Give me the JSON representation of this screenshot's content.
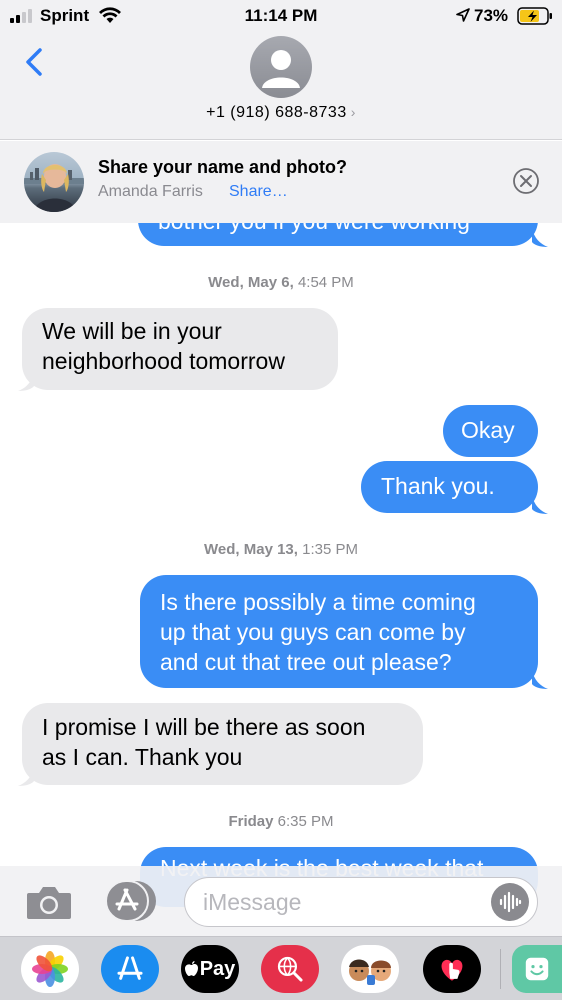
{
  "status_bar": {
    "carrier": "Sprint",
    "time": "11:14 PM",
    "battery_percent": "73%",
    "battery_level": 0.73,
    "signal_bars": 2,
    "icons": [
      "signal-icon",
      "wifi-icon",
      "location-icon",
      "battery-icon"
    ]
  },
  "header": {
    "back_icon": "chevron-left-icon",
    "avatar_icon": "person-icon",
    "phone_number": "+1 (918) 688-8733",
    "chevron": "›"
  },
  "share_banner": {
    "title": "Share your name and photo?",
    "name": "Amanda Farris",
    "share_link": "Share…",
    "close_icon": "close-circle-icon"
  },
  "messages": {
    "partial_top": "bother you if you were working",
    "ts1": {
      "day": "Wed, May 6,",
      "time": "4:54 PM"
    },
    "m1": {
      "direction": "in",
      "lines": [
        "We will be in your",
        "neighborhood tomorrow"
      ]
    },
    "m2": {
      "direction": "out",
      "text": "Okay"
    },
    "m3": {
      "direction": "out",
      "text": "Thank you."
    },
    "ts2": {
      "day": "Wed, May 13,",
      "time": "1:35 PM"
    },
    "m4": {
      "direction": "out",
      "lines": [
        "Is there possibly a time coming",
        "up that you guys can come by",
        "and cut that tree out please?"
      ]
    },
    "m5": {
      "direction": "in",
      "lines": [
        "I promise I will be there as soon",
        "as I can. Thank you"
      ]
    },
    "ts3": {
      "day": "Friday",
      "time": "6:35 PM"
    },
    "partial_bottom": "Next week is the best week that"
  },
  "input_bar": {
    "placeholder": "iMessage",
    "value": "",
    "camera_icon": "camera-icon",
    "apps_icon": "app-store-icon",
    "audio_icon": "waveform-icon"
  },
  "app_drawer": {
    "apps": [
      "photos-icon",
      "app-store-icon",
      "apple-pay-icon",
      "web-search-icon",
      "memoji-icon",
      "digital-touch-icon",
      "sticker-app-icon"
    ],
    "apple_pay_label": "Pay"
  },
  "colors": {
    "outgoing_bubble": "#3a8df5",
    "incoming_bubble": "#e9e9eb",
    "accent": "#2f7cf6",
    "bar_background": "#f1f1f3"
  }
}
